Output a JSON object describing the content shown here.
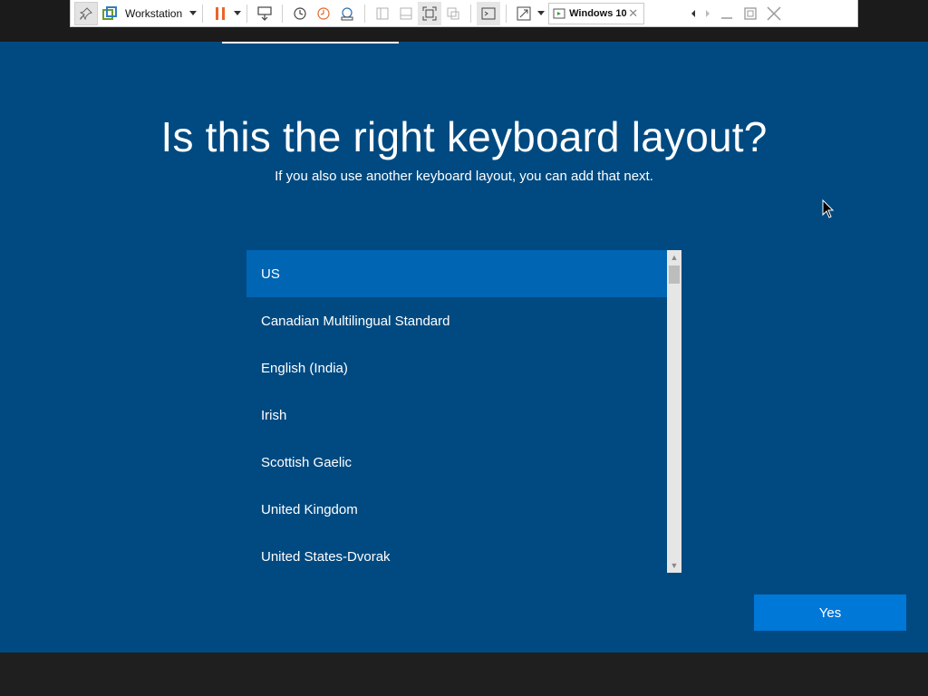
{
  "toolbar": {
    "product_label": "Workstation",
    "vm_tab_label": "Windows 10",
    "tab_close": "✕",
    "pin_icon": "pin-icon",
    "accent_color": "#e8662a"
  },
  "setup": {
    "title": "Is this the right keyboard layout?",
    "subtitle": "If you also use another keyboard layout, you can add that next.",
    "background_color": "#004a81",
    "layouts": [
      {
        "label": "US",
        "selected": true
      },
      {
        "label": "Canadian Multilingual Standard",
        "selected": false
      },
      {
        "label": "English (India)",
        "selected": false
      },
      {
        "label": "Irish",
        "selected": false
      },
      {
        "label": "Scottish Gaelic",
        "selected": false
      },
      {
        "label": "United Kingdom",
        "selected": false
      },
      {
        "label": "United States-Dvorak",
        "selected": false
      }
    ],
    "yes_label": "Yes",
    "selection_color": "#0065b3",
    "button_color": "#0078d7"
  }
}
